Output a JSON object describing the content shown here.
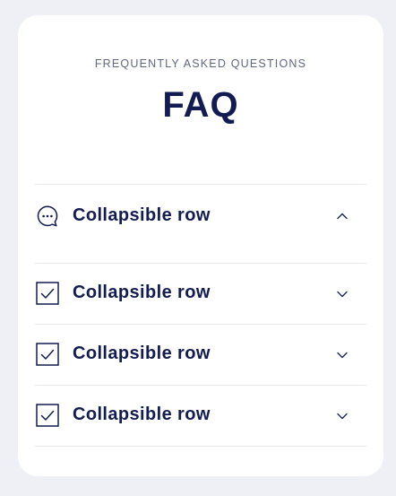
{
  "faq": {
    "eyebrow": "FREQUENTLY ASKED QUESTIONS",
    "title": "FAQ",
    "rows": [
      {
        "label": "Collapsible row",
        "icon": "chat-bubble-icon",
        "state": "expanded"
      },
      {
        "label": "Collapsible row",
        "icon": "checkbox-icon",
        "state": "collapsed"
      },
      {
        "label": "Collapsible row",
        "icon": "checkbox-icon",
        "state": "collapsed"
      },
      {
        "label": "Collapsible row",
        "icon": "checkbox-icon",
        "state": "collapsed"
      }
    ]
  },
  "colors": {
    "page_background": "#eef0f6",
    "card_background": "#ffffff",
    "text_primary": "#131c52",
    "text_secondary": "#5f6780",
    "divider": "#e6e8ef"
  }
}
